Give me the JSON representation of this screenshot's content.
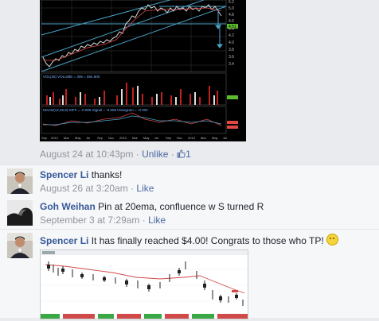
{
  "comments": [
    {
      "meta": {
        "timestamp": "August 24 at 10:43pm",
        "sep1": " · ",
        "action": "Unlike",
        "sep2": " · ",
        "likes": "1"
      }
    },
    {
      "author": "Spencer Li",
      "text": "thanks!",
      "meta": {
        "timestamp": "August 26 at 3:20am",
        "sep": " · ",
        "action": "Like"
      }
    },
    {
      "author": "Goh Weihan",
      "text": "Pin at 20ema, confluence w S turned R",
      "meta": {
        "timestamp": "September 3 at 7:29am",
        "sep": " · ",
        "action": "Like"
      }
    },
    {
      "author": "Spencer Li",
      "text": "It has finally reached $4.00! Congrats to those who TP!"
    }
  ],
  "chart1": {
    "right_axis": [
      "5.2",
      "5.0",
      "4.8",
      "4.6",
      "4.4",
      "4.2",
      "4.0",
      "3.8",
      "3.6",
      "3.4"
    ],
    "price_tag": "4.51",
    "volume_label": "VOL(25) VOLUME = 306 = 584.600",
    "macd_label": "MACD(12,26,9) DIFF = -0.006 Signal = -0.006 Histogram = -0.000",
    "x_labels": [
      "Sep",
      "2012",
      "Mar",
      "May",
      "Jul",
      "Sep",
      "Nov",
      "2013",
      "Mar",
      "May",
      "Jul",
      "Sep",
      "Nov",
      "2014",
      "Mar",
      "May",
      "Jul"
    ]
  },
  "colors": {
    "link": "#365899",
    "meta": "#90949c",
    "bg": "#e9ebee"
  }
}
